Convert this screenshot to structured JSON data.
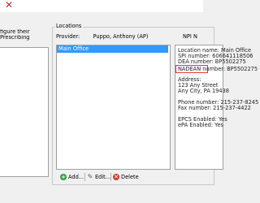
{
  "left_panel": {
    "line1": "figure their",
    "line2": "Prescribing"
  },
  "locations": {
    "group_title": "Locations",
    "provider_label": "Provider:",
    "provider_name": "Puppo, Anthony (AP)",
    "npi_label": "NPI N",
    "list": [
      "Main Office"
    ]
  },
  "details": {
    "location_name": "Location name: Main Office",
    "spi_number": "SPI number: 606641118506",
    "dea_number": "DEA number: BP5502275",
    "nadean_number": "NADEAN number: BP5502275",
    "address_label": "Address:",
    "address_line1": "123 Any Street",
    "address_line2": "Any City, PA 19438",
    "phone": "Phone number: 215-237-8245",
    "fax": "Fax number: 215-237-4422",
    "epcs": "EPCS Enabled: Yes",
    "epa": "ePA Enabled: Yes"
  },
  "toolbar": {
    "add_label": "Add...",
    "edit_label": "Edit...",
    "delete_label": "Delete"
  },
  "colors": {
    "selection": "#3399ff",
    "highlight_box": "#e53935",
    "close": "#c62828"
  }
}
